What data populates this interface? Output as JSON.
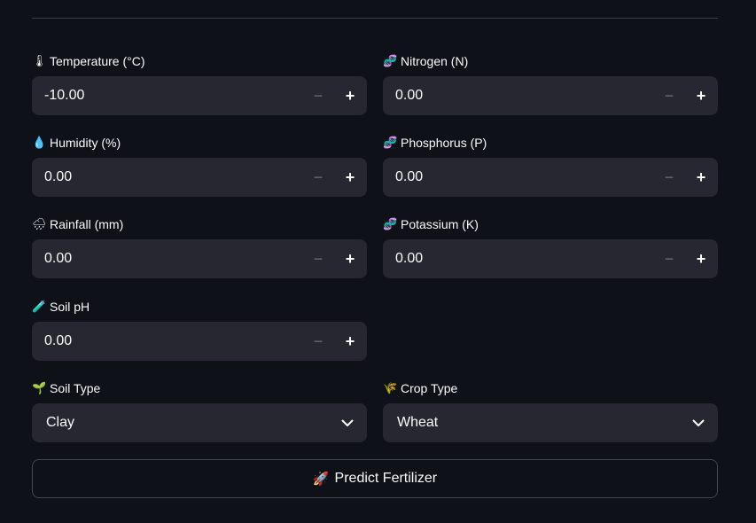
{
  "fields": {
    "temperature": {
      "icon": "thermometer-icon",
      "emoji": "🌡",
      "label": "Temperature (°C)",
      "value": "-10.00"
    },
    "nitrogen": {
      "icon": "dna-icon",
      "emoji": "🧬",
      "label": "Nitrogen (N)",
      "value": "0.00"
    },
    "humidity": {
      "icon": "droplet-icon",
      "emoji": "💧",
      "label": "Humidity (%)",
      "value": "0.00"
    },
    "phosphorus": {
      "icon": "dna-icon",
      "emoji": "🧬",
      "label": "Phosphorus (P)",
      "value": "0.00"
    },
    "rainfall": {
      "icon": "rain-cloud-icon",
      "emoji": "🌧",
      "label": "Rainfall (mm)",
      "value": "0.00"
    },
    "potassium": {
      "icon": "dna-icon",
      "emoji": "🧬",
      "label": "Potassium (K)",
      "value": "0.00"
    },
    "soil_ph": {
      "icon": "test-tube-icon",
      "emoji": "🧪",
      "label": "Soil pH",
      "value": "0.00"
    }
  },
  "selects": {
    "soil_type": {
      "icon": "seedling-icon",
      "emoji": "🌱",
      "label": "Soil Type",
      "value": "Clay"
    },
    "crop_type": {
      "icon": "wheat-icon",
      "emoji": "🌾",
      "label": "Crop Type",
      "value": "Wheat"
    }
  },
  "stepper": {
    "minus": "−",
    "plus": "+"
  },
  "predict_button": {
    "icon": "rocket-icon",
    "emoji": "🚀",
    "label": "Predict Fertilizer"
  },
  "colors": {
    "background": "#0e1117",
    "input": "#262730",
    "text": "#fafafa"
  }
}
